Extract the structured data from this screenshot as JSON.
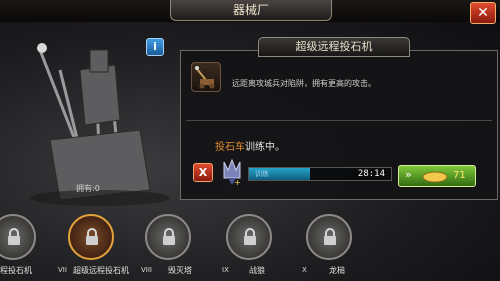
{
  "header": {
    "title": "器械厂"
  },
  "scene": {
    "owned_label": "拥有:0"
  },
  "panel": {
    "header": "超级远程投石机",
    "description": "远距离攻城兵对陷阱，拥有更高的攻击。",
    "status_unit": "投石车",
    "status_text": "训练中。"
  },
  "training": {
    "bar_label": "训练",
    "progress": 0.43,
    "timer": "28:14",
    "speedup_cost": "71"
  },
  "units": [
    {
      "numeral": "",
      "label": "程投石机",
      "active": false
    },
    {
      "numeral": "VII",
      "label": "超级远程投石机",
      "active": true
    },
    {
      "numeral": "VIII",
      "label": "毁灭塔",
      "active": false
    },
    {
      "numeral": "IX",
      "label": "战狼",
      "active": false
    },
    {
      "numeral": "X",
      "label": "龙槌",
      "active": false
    }
  ],
  "colors": {
    "accent": "#e28a2c",
    "progress": "#27a4c9",
    "speedup": "#7fc93b",
    "close": "#e14b30"
  }
}
